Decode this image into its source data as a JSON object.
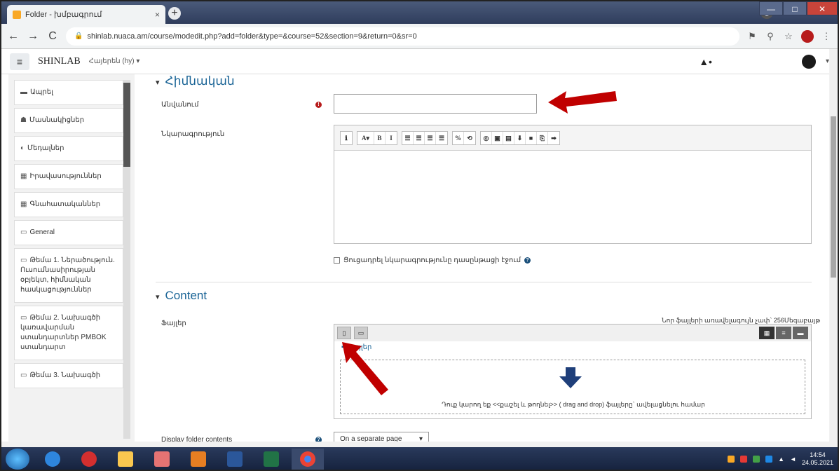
{
  "browser": {
    "tab_title": "Folder - խմբագրում",
    "tab_close": "×",
    "new_tab": "+",
    "url": "shinlab.nuaca.am/course/modedit.php?add=folder&type=&course=52&section=9&return=0&sr=0",
    "window_buttons": [
      "—",
      "□",
      "✕"
    ]
  },
  "navbar": {
    "menu_glyph": "≡",
    "brand": "SHINLAB",
    "language": "Հայերեն (hy) ▾",
    "user_caret": "▾"
  },
  "sidebar": {
    "items": [
      {
        "icon": "▬",
        "label": "Ապրել"
      },
      {
        "icon": "☗",
        "label": "Մասնակիցներ"
      },
      {
        "icon": "◐",
        "label": "Մեդալներ"
      },
      {
        "icon": "▦",
        "label": "Իրավասություններ"
      },
      {
        "icon": "▦",
        "label": "Գնահատականներ"
      },
      {
        "icon": "▭",
        "label": "General"
      },
      {
        "icon": "▭",
        "label": "Թեմա 1. Ներածություն. Ուսումնասիրության օբյեկտ, հիմնական հասկացություններ"
      },
      {
        "icon": "▭",
        "label": "Թեմա 2. Նախագծի կառավարման ստանդարտներ PMBOK ստանդարտ"
      },
      {
        "icon": "▭",
        "label": "Թեմա 3. Նախագծի"
      }
    ]
  },
  "form": {
    "section_general": "Հիմնական",
    "name_label": "Անվանում",
    "name_value": "",
    "description_label": "Նկարագրություն",
    "editor_buttons": [
      "ℹ",
      "A▾",
      "B",
      "I",
      "☰",
      "☰",
      "☰",
      "☰",
      "%",
      "⟲",
      "◎",
      "▣",
      "▤",
      "⬇",
      "■",
      "⎘",
      "➡"
    ],
    "autosave_label": "Ցուցադրել նկարագրությունը դասընթացի էջում",
    "section_content": "Content",
    "files_label": "Ֆայլեր",
    "max_size": "Նոր ֆայլերի առավելագույն չափ` 256Մեգաբայթ",
    "files_crumb": "Ֆայլեր",
    "drop_text": "Դուք կարող եք <<քաշել և թողնել>> ( drag and drop) ֆայլերը` ավելացնելու համար",
    "display_label": "Display folder contents",
    "display_value": "On a separate page",
    "display_caret": "▾"
  },
  "taskbar": {
    "clock_time": "14:54",
    "clock_date": "24.05.2021"
  },
  "colors": {
    "accent": "#1a6496",
    "arrow": "#c00000",
    "required": "#b71c1c"
  }
}
